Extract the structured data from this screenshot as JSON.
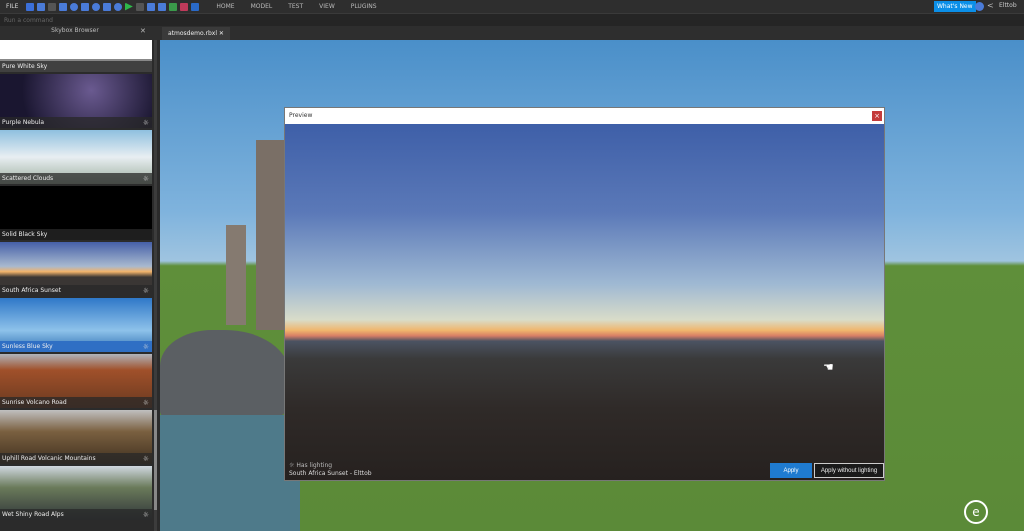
{
  "menu": {
    "file": "FILE",
    "items": [
      "HOME",
      "MODEL",
      "TEST",
      "VIEW",
      "PLUGINS"
    ],
    "whats_new": "What's New",
    "user": "Elttob"
  },
  "command_bar": {
    "placeholder": "Run a command"
  },
  "sidebar": {
    "title": "Skybox Browser",
    "items": [
      {
        "label": "Pure White Sky",
        "lighting": false,
        "selected": false,
        "bg": "linear-gradient(#fff 60%,#888 60%)"
      },
      {
        "label": "Purple Nebula",
        "lighting": true,
        "selected": false,
        "bg": "radial-gradient(circle at 60% 30%,#6a5a90,#1a1630 70%)"
      },
      {
        "label": "Scattered Clouds",
        "lighting": true,
        "selected": false,
        "bg": "linear-gradient(#8fc0df,#e8eef2 50%,#9eb0a0)"
      },
      {
        "label": "Solid Black Sky",
        "lighting": false,
        "selected": false,
        "bg": "#000"
      },
      {
        "label": "South Africa Sunset",
        "lighting": true,
        "selected": false,
        "bg": "linear-gradient(#4660a8,#a8b9cf 45%,#f2b36a 55%,#3a3634 65%)"
      },
      {
        "label": "Sunless Blue Sky",
        "lighting": true,
        "selected": true,
        "bg": "linear-gradient(#2f78c8,#8ec2ea 60%,#2c6db0)"
      },
      {
        "label": "Sunrise Volcano Road",
        "lighting": true,
        "selected": false,
        "bg": "linear-gradient(#b0b4bc,#a0502a 30%,#6a3a20)"
      },
      {
        "label": "Uphill Road Volcanic Mountains",
        "lighting": true,
        "selected": false,
        "bg": "linear-gradient(#c0c0c0,#7a6040 40%,#403020)"
      },
      {
        "label": "Wet Shiny Road Alps",
        "lighting": true,
        "selected": false,
        "bg": "linear-gradient(#d0d8e0,#6a7a5a 40%,#30353a)"
      }
    ]
  },
  "document_tab": "atmosdemo.rbxl",
  "preview": {
    "title": "Preview",
    "has_lighting": "Has lighting",
    "credit": "South Africa Sunset - Elttob",
    "apply": "Apply",
    "apply_without_lighting": "Apply without lighting"
  }
}
